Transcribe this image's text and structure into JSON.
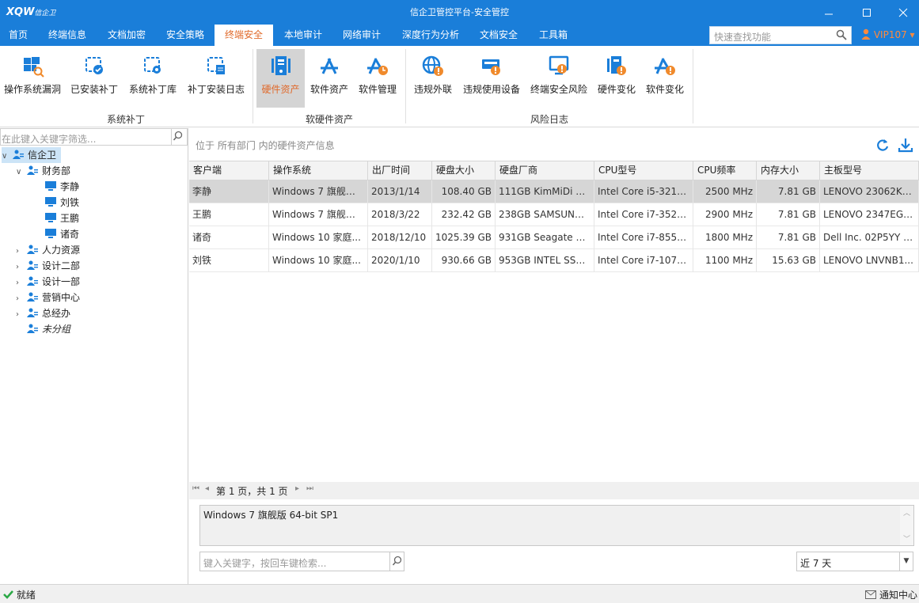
{
  "window": {
    "logo_main": "XQW",
    "logo_sub": "信企卫",
    "title": "信企卫管控平台-安全管控",
    "controls": [
      "minimize-icon",
      "maximize-icon",
      "close-icon"
    ]
  },
  "menu": {
    "tabs": [
      "首页",
      "终端信息",
      "文档加密",
      "安全策略",
      "终端安全",
      "本地审计",
      "网络审计",
      "深度行为分析",
      "文档安全",
      "工具箱"
    ],
    "active_tab": "终端安全",
    "search_placeholder": "快速查找功能",
    "user": "VIP107",
    "accent": "#1a7ed9",
    "active_color": "#e0692a"
  },
  "ribbon": {
    "groups": [
      {
        "label": "系统补丁",
        "buttons": [
          "操作系统漏洞",
          "已安装补丁",
          "系统补丁库",
          "补丁安装日志"
        ]
      },
      {
        "label": "软硬件资产",
        "buttons": [
          "硬件资产",
          "软件资产",
          "软件管理"
        ]
      },
      {
        "label": "风险日志",
        "buttons": [
          "违规外联",
          "违规使用设备",
          "终端安全风险",
          "硬件变化",
          "软件变化"
        ]
      }
    ],
    "active_button": "硬件资产"
  },
  "tree": {
    "filter_placeholder": "在此键入关键字筛选...",
    "root": "信企卫",
    "dept_finance": "财务部",
    "finance_members": [
      "李静",
      "刘铁",
      "王鹏",
      "诸奇"
    ],
    "departments": [
      "人力资源",
      "设计二部",
      "设计一部",
      "营销中心",
      "总经办"
    ],
    "ungrouped": "未分组"
  },
  "main": {
    "breadcrumb": "位于 所有部门 内的硬件资产信息",
    "columns": [
      "客户端",
      "操作系统",
      "出厂时间",
      "硬盘大小",
      "硬盘厂商",
      "CPU型号",
      "CPU频率",
      "内存大小",
      "主板型号"
    ],
    "rows": [
      [
        "李静",
        "Windows 7 旗舰版...",
        "2013/1/14",
        "108.40 GB",
        "111GB KimMiDi S...",
        "Intel Core i5-3210...",
        "2500 MHz",
        "7.81 GB",
        "LENOVO 23062K9 ..."
      ],
      [
        "王鹏",
        "Windows 7 旗舰版...",
        "2018/3/22",
        "232.42 GB",
        "238GB SAMSUNG...",
        "Intel Core i7-3520...",
        "2900 MHz",
        "7.81 GB",
        "LENOVO 2347EG4 ..."
      ],
      [
        "诸奇",
        "Windows 10 家庭...",
        "2018/12/10",
        "1025.39 GB",
        "931GB Seagate ST...",
        "Intel Core i7-8550...",
        "1800 MHz",
        "7.81 GB",
        "Dell Inc. 02P5YY (U..."
      ],
      [
        "刘铁",
        "Windows 10 家庭...",
        "2020/1/10",
        "930.66 GB",
        "953GB INTEL SSD...",
        "Intel Core i7-1071...",
        "1100 MHz",
        "15.63 GB",
        "LENOVO LNVNB1..."
      ]
    ],
    "selected_row": 0,
    "pager_text": "第 1 页，共 1 页",
    "detail_text": "Windows 7 旗舰版 64-bit SP1",
    "keyword_placeholder": "键入关键字，按回车键检索...",
    "range_value": "近 7 天"
  },
  "status": {
    "left": "就绪",
    "right": "通知中心"
  }
}
